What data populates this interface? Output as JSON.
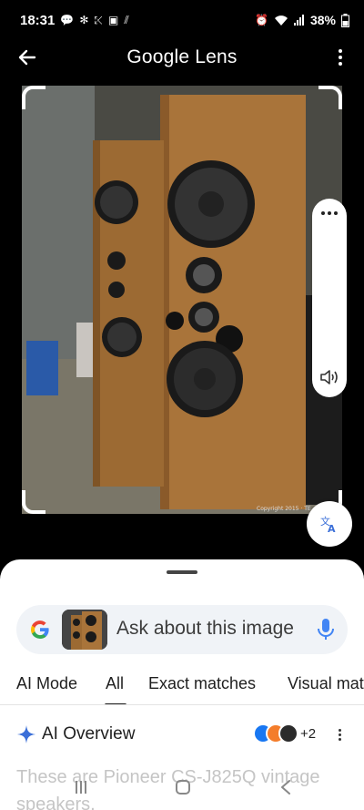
{
  "status": {
    "time": "18:31",
    "battery": "38%"
  },
  "app_bar": {
    "title": "Google Lens"
  },
  "search": {
    "placeholder": "Ask about this image"
  },
  "tabs": [
    {
      "label": "AI Mode"
    },
    {
      "label": "All"
    },
    {
      "label": "Exact matches"
    },
    {
      "label": "Visual matches"
    }
  ],
  "overview": {
    "label": "AI Overview",
    "extra_sources": "+2"
  },
  "answer": {
    "text": "These are Pioneer CS-J825Q vintage speakers."
  },
  "photo": {
    "watermark": "Copyright 2015 · TE"
  },
  "icons": {
    "back": "arrow-left-icon",
    "more": "more-vert-icon",
    "translate": "translate-icon",
    "speaker": "volume-icon",
    "mic": "mic-icon",
    "sparkle": "sparkle-icon"
  }
}
